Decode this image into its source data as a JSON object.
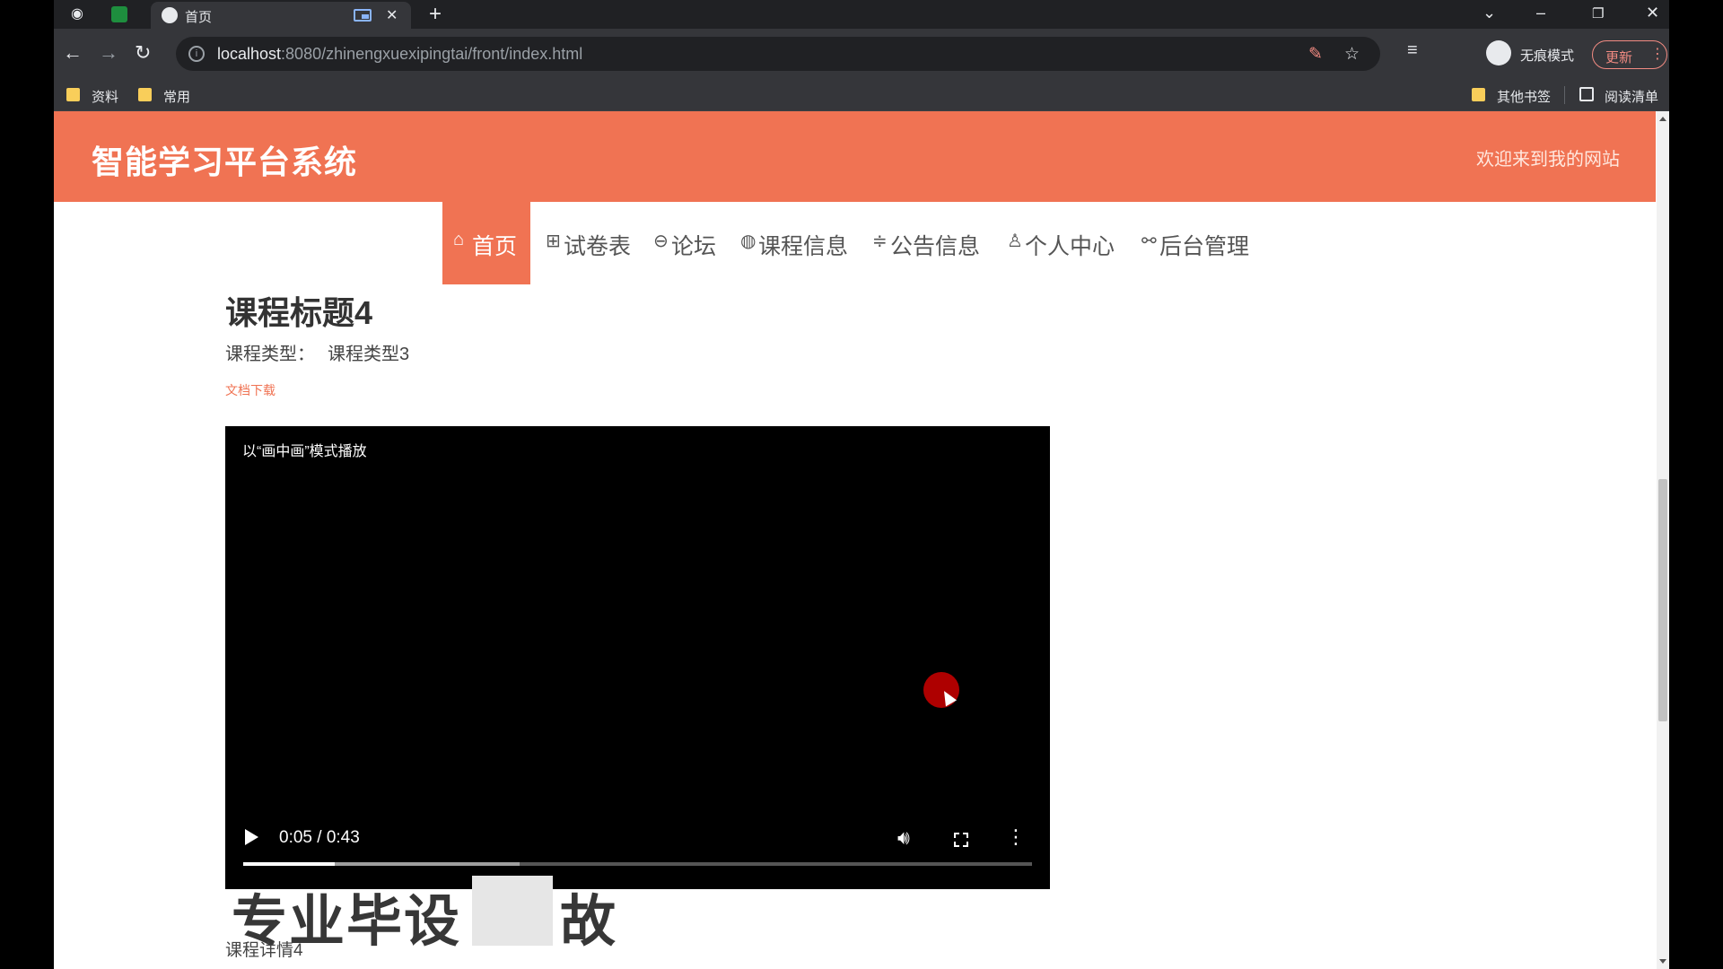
{
  "browser": {
    "tab": {
      "title": "首页"
    },
    "url": {
      "host": "localhost",
      "path": ":8080/zhinengxuexipingtai/front/index.html"
    },
    "incognito_label": "无痕模式",
    "update_label": "更新",
    "bookmarks": [
      {
        "label": "资料"
      },
      {
        "label": "常用"
      }
    ],
    "other_bookmarks": "其他书签",
    "reading_list": "阅读清单"
  },
  "header": {
    "brand": "智能学习平台系统",
    "welcome": "欢迎来到我的网站"
  },
  "nav": {
    "items": [
      {
        "icon": "home-icon",
        "label": "首页",
        "active": true
      },
      {
        "icon": "grid-icon",
        "label": "试卷表"
      },
      {
        "icon": "chat-icon",
        "label": "论坛"
      },
      {
        "icon": "globe-icon",
        "label": "课程信息"
      },
      {
        "icon": "sliders-icon",
        "label": "公告信息"
      },
      {
        "icon": "user-icon",
        "label": "个人中心"
      },
      {
        "icon": "link-icon",
        "label": "后台管理"
      }
    ]
  },
  "course": {
    "title": "课程标题4",
    "type_label": "课程类型：",
    "type_value": "课程类型3",
    "doc_link": "文档下载",
    "detail": "课程详情4"
  },
  "video": {
    "pip_label": "以“画中画”模式播放",
    "time": "0:05 / 0:43",
    "played_fraction": 0.116,
    "buffered_fraction": 0.35
  },
  "watermark": "专业毕设",
  "watermark_tail": "故",
  "colors": {
    "accent": "#f07353"
  }
}
